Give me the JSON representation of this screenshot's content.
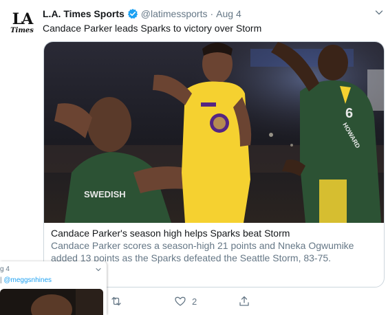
{
  "tweet": {
    "avatar_line1": "LA",
    "avatar_line2": "Times",
    "display_name": "L.A. Times Sports",
    "handle": "@latimessports",
    "separator": "·",
    "date": "Aug 4",
    "text": "Candace Parker leads Sparks to victory over Storm",
    "card": {
      "title": "Candace Parker's season high helps Sparks beat Storm",
      "description": "Candace Parker scores a season-high 21 points and Nneka Ogwumike added 13 points as the Sparks defeated the Seattle Storm, 83-75.",
      "jersey_number": "6",
      "jersey_name": "HOWARD",
      "jersey_sponsor": "SWEDISH"
    },
    "actions": {
      "like_count": "2"
    }
  },
  "overlay_tweet": {
    "date": "g 4",
    "separator": "|",
    "handle": "@meggsnhines"
  },
  "colors": {
    "link_blue": "#1da1f2",
    "secondary_text": "#657786",
    "border": "#ccd6dd",
    "sparks_gold": "#f5d130",
    "storm_green": "#2c5234"
  },
  "icons": [
    "verified-badge-icon",
    "chevron-down-icon",
    "retweet-icon",
    "heart-icon",
    "share-icon"
  ]
}
